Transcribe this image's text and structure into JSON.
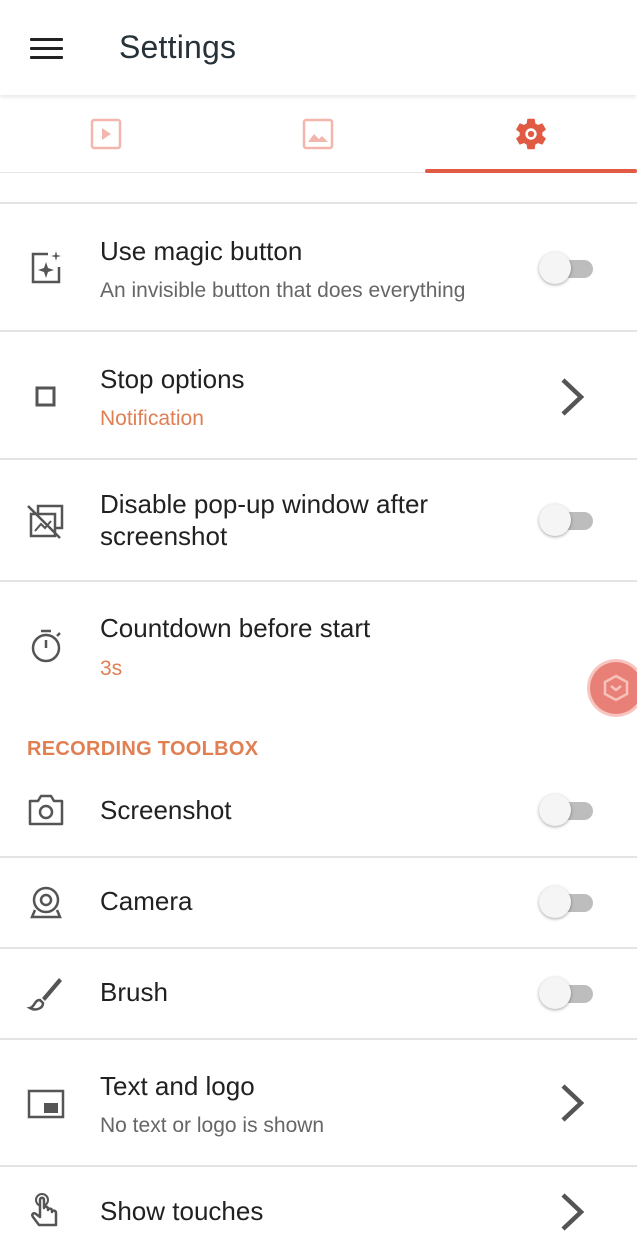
{
  "appbar": {
    "title": "Settings"
  },
  "tabs": [
    {
      "name": "video",
      "icon": "video-play-icon",
      "selected": false
    },
    {
      "name": "image",
      "icon": "image-icon",
      "selected": false
    },
    {
      "name": "settings",
      "icon": "gear-icon",
      "selected": true
    }
  ],
  "colors": {
    "accent": "#e05a44",
    "accent_text": "#e07f52",
    "divider": "#e4e4e4"
  },
  "settings": {
    "magic_button": {
      "title": "Use magic button",
      "subtitle": "An invisible button that does everything",
      "enabled": false
    },
    "stop_options": {
      "title": "Stop options",
      "value": "Notification"
    },
    "disable_popup": {
      "title": "Disable pop-up window after screenshot",
      "enabled": false
    },
    "countdown": {
      "title": "Countdown before start",
      "value": "3s"
    }
  },
  "recording_toolbox": {
    "header": "RECORDING TOOLBOX",
    "screenshot": {
      "title": "Screenshot",
      "enabled": false
    },
    "camera": {
      "title": "Camera",
      "enabled": false
    },
    "brush": {
      "title": "Brush",
      "enabled": false
    },
    "text_logo": {
      "title": "Text and logo",
      "subtitle": "No text or logo is shown"
    },
    "show_touches": {
      "title": "Show touches"
    }
  }
}
